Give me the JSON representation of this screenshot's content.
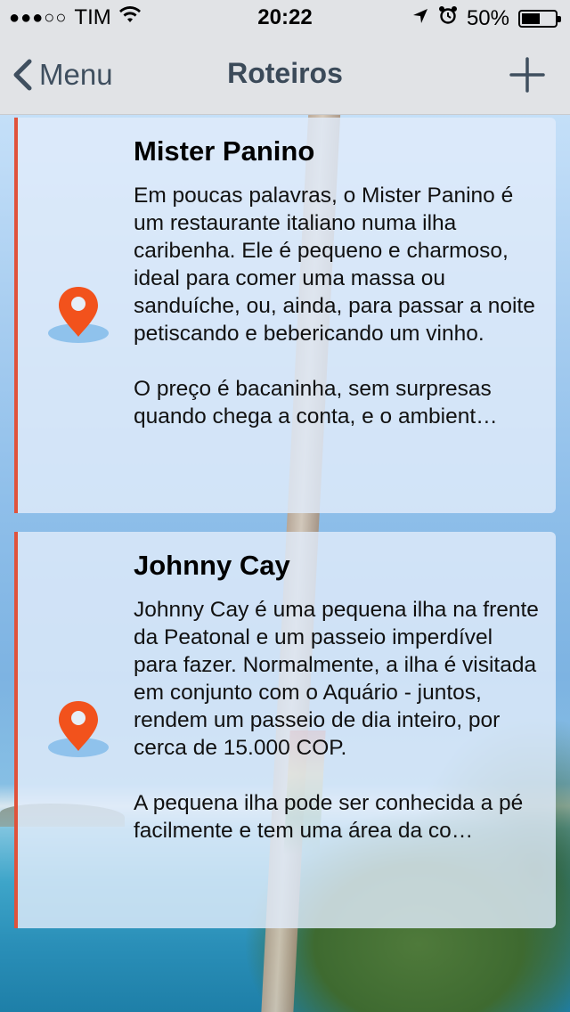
{
  "status_bar": {
    "signal_dots": "●●●○○",
    "carrier": "TIM",
    "time": "20:22",
    "battery_percent": "50%",
    "icons": [
      "wifi-icon",
      "location-arrow-icon",
      "alarm-icon",
      "battery-icon"
    ]
  },
  "nav": {
    "back_label": "Menu",
    "title": "Roteiros",
    "add_icon": "plus-icon"
  },
  "cards": [
    {
      "title": "Mister Panino",
      "description": "Em poucas palavras, o Mister Panino é um restaurante italiano numa ilha caribenha. Ele é pequeno e charmoso, ideal para comer uma massa ou sanduíche, ou, ainda, para passar a noite petiscando e bebericando um vinho.\n\nO preço é bacaninha, sem surpresas quando chega a conta, e o ambient…",
      "icon": "map-pin-icon"
    },
    {
      "title": "Johnny Cay",
      "description": "Johnny Cay é uma pequena ilha na frente da Peatonal e um passeio imperdível para fazer. Normalmente, a ilha é visitada em conjunto com o Aquário - juntos, rendem um passeio de dia inteiro, por cerca de 15.000 COP.\n\nA pequena ilha pode ser conhecida a pé facilmente e tem uma área da co…",
      "icon": "map-pin-icon"
    }
  ],
  "colors": {
    "accent": "#e0523b",
    "pin": "#f2521c",
    "nav_text": "#3b4a59"
  }
}
